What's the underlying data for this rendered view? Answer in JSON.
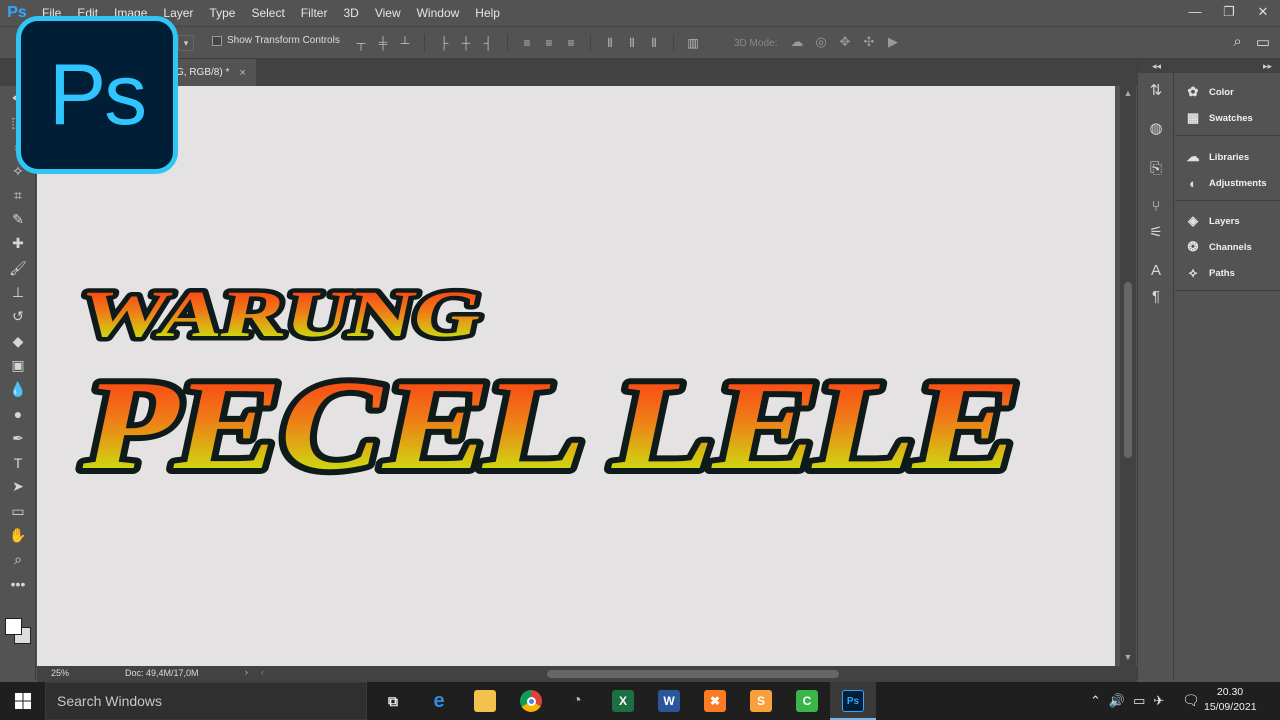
{
  "app": {
    "logo_text": "Ps"
  },
  "menubar": {
    "items": [
      "File",
      "Edit",
      "Image",
      "Layer",
      "Type",
      "Select",
      "Filter",
      "3D",
      "View",
      "Window",
      "Help"
    ]
  },
  "window_controls": {
    "minimize": "—",
    "restore": "❐",
    "close": "✕"
  },
  "options_bar": {
    "show_transform_controls": "Show Transform Controls",
    "mode_3d": "3D Mode:"
  },
  "document": {
    "tab_label": "G, RGB/8) *",
    "tab_close": "×"
  },
  "canvas_text": {
    "line1": "WARUNG",
    "line2": "PECEL LELE"
  },
  "status_bar": {
    "zoom": "25%",
    "doc_size": "Doc: 49,4M/17,0M"
  },
  "panels": {
    "items": [
      {
        "label": "Color",
        "icon": "palette-icon"
      },
      {
        "label": "Swatches",
        "icon": "grid-icon"
      },
      {
        "label": "Libraries",
        "icon": "cloud-icon"
      },
      {
        "label": "Adjustments",
        "icon": "adjust-icon"
      },
      {
        "label": "Layers",
        "icon": "layers-icon"
      },
      {
        "label": "Channels",
        "icon": "channels-icon"
      },
      {
        "label": "Paths",
        "icon": "paths-icon"
      }
    ]
  },
  "taskbar": {
    "search_placeholder": "Search Windows",
    "time": "20.30",
    "date": "15/09/2021"
  },
  "colors": {
    "ps_blue": "#31c5f4",
    "ps_dark": "#001e36",
    "text_gradient_top": "#ff3b1a",
    "text_gradient_bottom": "#d4d40a",
    "text_stroke": "#0f1a1a"
  }
}
